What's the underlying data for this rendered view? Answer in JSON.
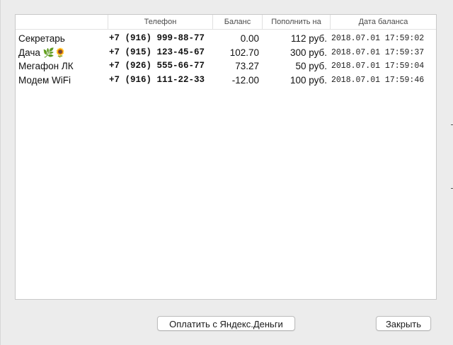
{
  "table": {
    "columns": [
      "",
      "Телефон",
      "Баланс",
      "Пополнить на",
      "Дата баланса"
    ],
    "rows": [
      {
        "name": "Секретарь",
        "emoji": "",
        "phone": "+7 (916) 999-88-77",
        "balance": "0.00",
        "topup": "112 руб.",
        "date": "2018.07.01 17:59:02"
      },
      {
        "name": "Дача",
        "emoji": "🌿🌻",
        "phone": "+7 (915) 123-45-67",
        "balance": "102.70",
        "topup": "300 руб.",
        "date": "2018.07.01 17:59:37"
      },
      {
        "name": "Мегафон ЛК",
        "emoji": "",
        "phone": "+7 (926) 555-66-77",
        "balance": "73.27",
        "topup": "50 руб.",
        "date": "2018.07.01 17:59:04"
      },
      {
        "name": "Модем WiFi",
        "emoji": "",
        "phone": "+7 (916) 111-22-33",
        "balance": "-12.00",
        "topup": "100 руб.",
        "date": "2018.07.01 17:59:46"
      }
    ]
  },
  "buttons": {
    "pay_label": "Оплатить с Яндекс.Деньги",
    "close_label": "Закрыть"
  }
}
